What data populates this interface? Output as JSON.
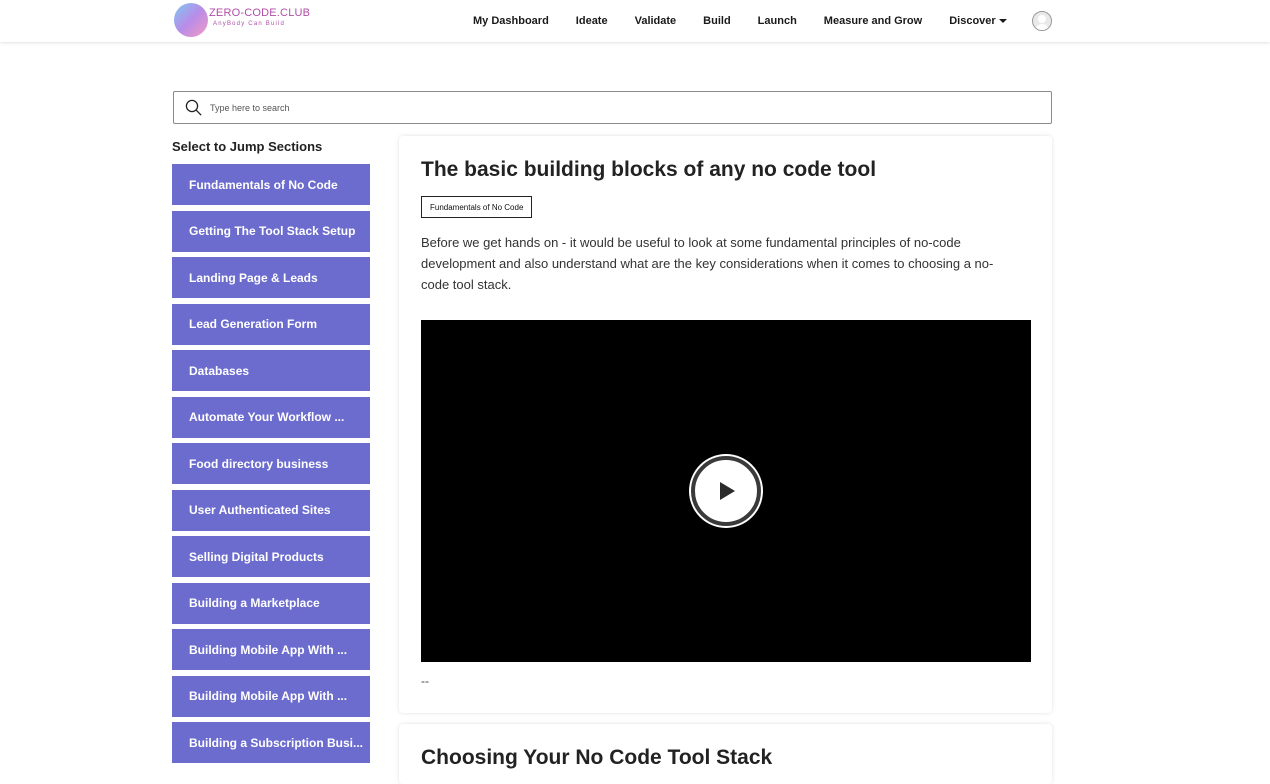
{
  "brand": {
    "title": "ZERO-CODE.CLUB",
    "tagline": "AnyBody Can Build"
  },
  "nav": {
    "items": [
      "My Dashboard",
      "Ideate",
      "Validate",
      "Build",
      "Launch",
      "Measure and Grow"
    ],
    "discover_label": "Discover"
  },
  "search": {
    "placeholder": "Type here to search",
    "value": ""
  },
  "sidebar": {
    "title": "Select to Jump Sections",
    "items": [
      {
        "label": "Fundamentals of No Code"
      },
      {
        "label": "Getting The Tool Stack Setup"
      },
      {
        "label": "Landing Page & Leads"
      },
      {
        "label": "Lead Generation Form"
      },
      {
        "label": "Databases"
      },
      {
        "label": "Automate Your Workflow ..."
      },
      {
        "label": "Food directory business"
      },
      {
        "label": "User Authenticated Sites"
      },
      {
        "label": "Selling Digital Products"
      },
      {
        "label": "Building a Marketplace"
      },
      {
        "label": "Building Mobile App With ..."
      },
      {
        "label": "Building Mobile App With ..."
      },
      {
        "label": "Building a Subscription Busi..."
      }
    ]
  },
  "lesson": {
    "title": "The basic building blocks of any no code tool",
    "tag": "Fundamentals of No Code",
    "description": "Before we get hands on - it would be useful to look at some fundamental principles of no-code development and also understand what are the key considerations when it comes to choosing a no-code tool stack.",
    "footer": "--"
  },
  "next_lesson": {
    "title": "Choosing Your No Code Tool Stack"
  },
  "colors": {
    "sidebar_bg": "#6c6ccf",
    "brand_text": "#b04ea8"
  }
}
